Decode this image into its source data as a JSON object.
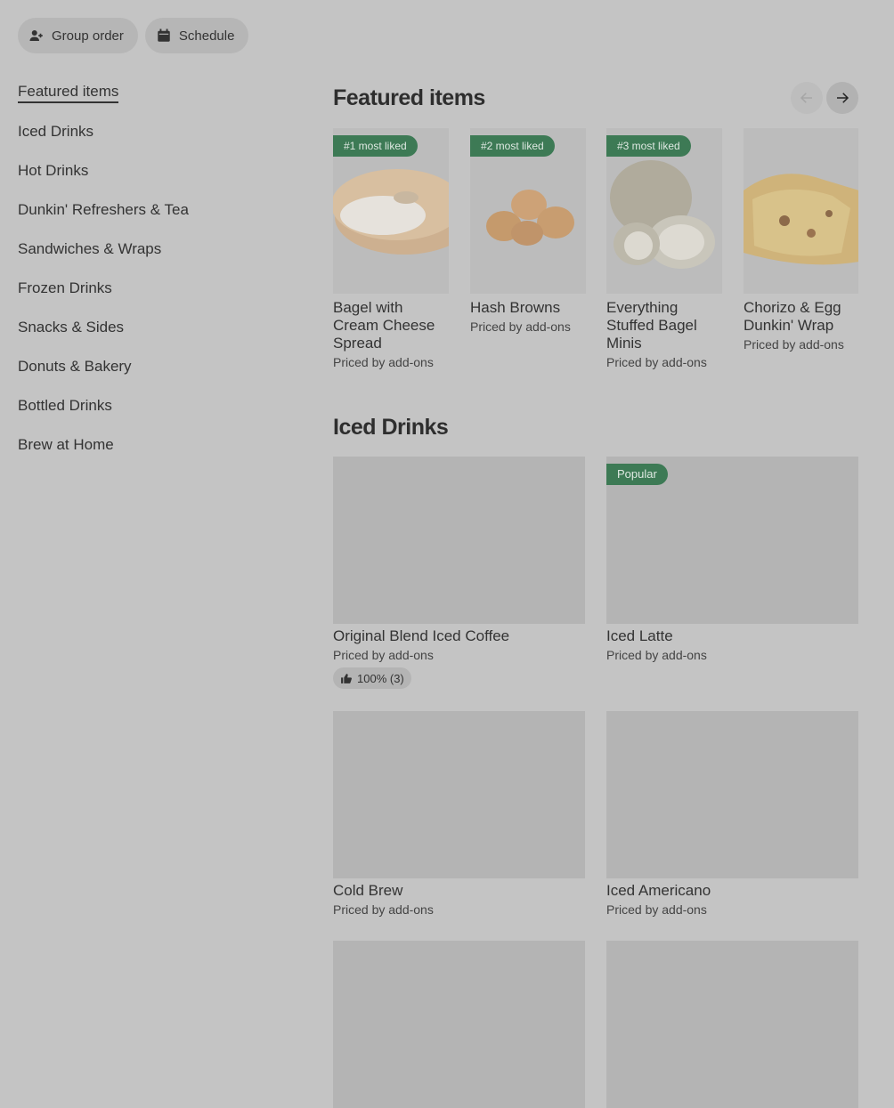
{
  "topbar": {
    "group_order_label": "Group order",
    "schedule_label": "Schedule"
  },
  "sidebar": {
    "items": [
      {
        "label": "Featured items"
      },
      {
        "label": "Iced Drinks"
      },
      {
        "label": "Hot Drinks"
      },
      {
        "label": "Dunkin' Refreshers & Tea"
      },
      {
        "label": "Sandwiches & Wraps"
      },
      {
        "label": "Frozen Drinks"
      },
      {
        "label": "Snacks & Sides"
      },
      {
        "label": "Donuts & Bakery"
      },
      {
        "label": "Bottled Drinks"
      },
      {
        "label": "Brew at Home"
      }
    ]
  },
  "featured": {
    "title": "Featured items",
    "items": [
      {
        "badge": "#1 most liked",
        "name": "Bagel with Cream Cheese Spread",
        "price": "Priced by add-ons"
      },
      {
        "badge": "#2 most liked",
        "name": "Hash Browns",
        "price": "Priced by add-ons"
      },
      {
        "badge": "#3 most liked",
        "name": "Everything Stuffed Bagel Minis",
        "price": "Priced by add-ons"
      },
      {
        "badge": "",
        "name": "Chorizo & Egg Dunkin' Wrap",
        "price": "Priced by add-ons"
      }
    ]
  },
  "iced": {
    "title": "Iced Drinks",
    "items": [
      {
        "badge": "",
        "name": "Original Blend Iced Coffee",
        "price": "Priced by add-ons",
        "rating": "100% (3)"
      },
      {
        "badge": "Popular",
        "name": "Iced Latte",
        "price": "Priced by add-ons"
      },
      {
        "badge": "",
        "name": "Cold Brew",
        "price": "Priced by add-ons"
      },
      {
        "badge": "",
        "name": "Iced Americano",
        "price": "Priced by add-ons"
      }
    ]
  }
}
